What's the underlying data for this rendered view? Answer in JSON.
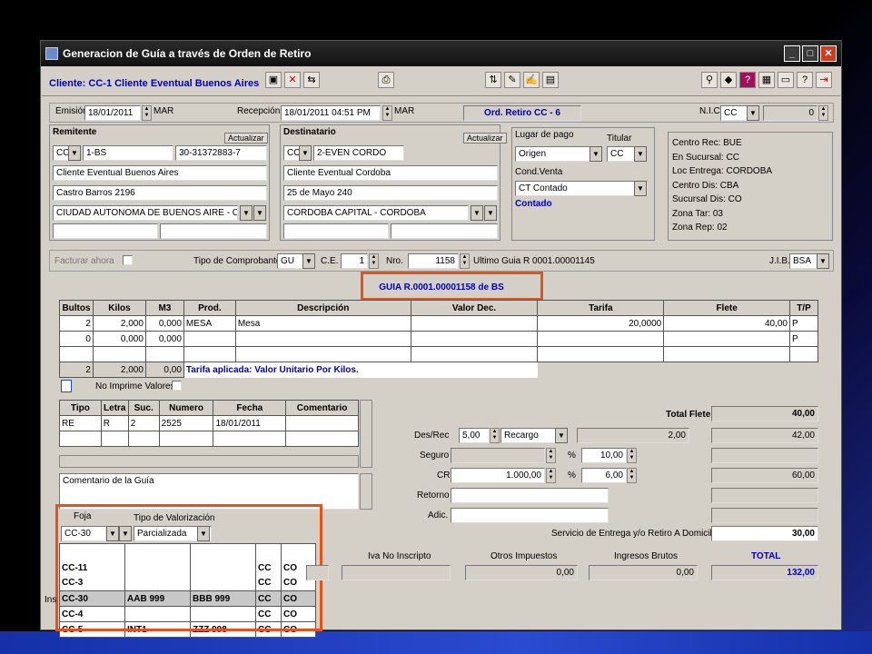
{
  "window": {
    "title": "Generacion de Guía a través de Orden de Retiro"
  },
  "toolbar": {
    "client": "Cliente: CC-1 Cliente Eventual Buenos Aires"
  },
  "header": {
    "emision_label": "Emisión",
    "emision_value": "18/01/2011",
    "emision_day": "MAR",
    "recepcion_label": "Recepción",
    "recepcion_value": "18/01/2011 04:51 PM",
    "recepcion_day": "MAR",
    "orden": "Ord. Retiro CC - 6",
    "nic_label": "N.I.C.",
    "nic_value": "CC",
    "nic_num": "0"
  },
  "remitente": {
    "title": "Remitente",
    "refresh": "Actualizar",
    "type": "CC",
    "code": "1-BS",
    "cuit": "30-31372883-7",
    "name": "Cliente Eventual Buenos Aires",
    "address": "Castro Barros 2196",
    "city": "CIUDAD AUTONOMA DE BUENOS AIRE - C"
  },
  "destinatario": {
    "title": "Destinatario",
    "refresh": "Actualizar",
    "type": "CC",
    "code": "2-EVEN CORDO",
    "name": "Cliente Eventual Cordoba",
    "address": "25 de Mayo 240",
    "city": "CORDOBA CAPITAL - CORDOBA"
  },
  "pago": {
    "lugar_label": "Lugar de pago",
    "titular_label": "Titular",
    "lugar_value": "Origen",
    "titular_value": "CC",
    "cond_label": "Cond.Venta",
    "cond_value": "CT Contado",
    "contado": "Contado"
  },
  "info": {
    "lines": [
      "Centro Rec: BUE",
      "En Sucursal: CC",
      "Loc Entrega: CORDOBA",
      "Centro Dis: CBA",
      "Sucursal Dis: CO",
      "Zona Tar: 03",
      "Zona Rep: 02"
    ]
  },
  "comprobante": {
    "facturar": "Facturar ahora",
    "tipo_label": "Tipo de Comprobante",
    "tipo_value": "GU",
    "ce_label": "C.E.",
    "ce_value": "1",
    "nro_label": "Nro.",
    "nro_value": "1158",
    "ultimo": "Ultimo Guia R 0001.00001145",
    "jib_label": "J.I.B.",
    "jib_value": "BSA"
  },
  "guia_title": "GUIA R.0001.00001158 de BS",
  "items": {
    "headers": [
      "Bultos",
      "Kilos",
      "M3",
      "Prod.",
      "Descripción",
      "Valor Dec.",
      "Tarifa",
      "Flete",
      "T/P"
    ],
    "rows": [
      [
        "2",
        "2,000",
        "0,000",
        "MESA",
        "Mesa",
        "",
        "20,0000",
        "40,00",
        "P"
      ],
      [
        "0",
        "0,000",
        "0,000",
        "",
        "",
        "",
        "",
        "",
        "P"
      ],
      [
        "",
        "",
        "",
        "",
        "",
        "",
        "",
        "",
        ""
      ]
    ],
    "totals": [
      "2",
      "2,000",
      "0,00"
    ],
    "tarifa_note": "Tarifa aplicada: Valor Unitario Por Kilos."
  },
  "no_imprime": "No Imprime Valores",
  "docs": {
    "headers": [
      "Tipo",
      "Letra",
      "Suc.",
      "Numero",
      "Fecha",
      "Comentario"
    ],
    "row": [
      "RE",
      "R",
      "2",
      "2525",
      "18/01/2011",
      ""
    ]
  },
  "comentario": "Comentario de la Guía",
  "foja": {
    "foja_label": "Foja",
    "tipo_label": "Tipo de Valorización",
    "foja_value": "CC-30",
    "tipo_value": "Parcializada",
    "rows": [
      [
        "CC-11",
        "",
        "",
        "CC",
        "CO"
      ],
      [
        "CC-3",
        "",
        "",
        "CC",
        "CO"
      ],
      [
        "CC-30",
        "AAB 999",
        "BBB 999",
        "CC",
        "CO"
      ],
      [
        "CC-4",
        "",
        "",
        "CC",
        "CO"
      ],
      [
        "CC-5",
        "INT1",
        "ZZZ 998",
        "CC",
        "CO"
      ]
    ]
  },
  "totales": {
    "total_flete_label": "Total Flete",
    "total_flete": "40,00",
    "desrec_label": "Des/Rec",
    "desrec_value": "5,00",
    "desrec_type": "Recargo",
    "desrec_amt": "2,00",
    "desrec_right": "42,00",
    "seguro_label": "Seguro",
    "seguro_pct": "10,00",
    "cr_label": "CR",
    "cr_value": "1.000,00",
    "cr_pct": "6,00",
    "cr_right": "60,00",
    "retorno_label": "Retorno",
    "adic_label": "Adic.",
    "servicio_label": "Servicio de Entrega y/o Retiro A Domicilio",
    "servicio_value": "30,00",
    "iva_label": "Iva No Inscripto",
    "otros_label": "Otros Impuestos",
    "otros_value": "0,00",
    "ingresos_label": "Ingresos Brutos",
    "ingresos_value": "0,00",
    "total_label": "TOTAL",
    "total_value": "132,00"
  },
  "status": "Ins"
}
